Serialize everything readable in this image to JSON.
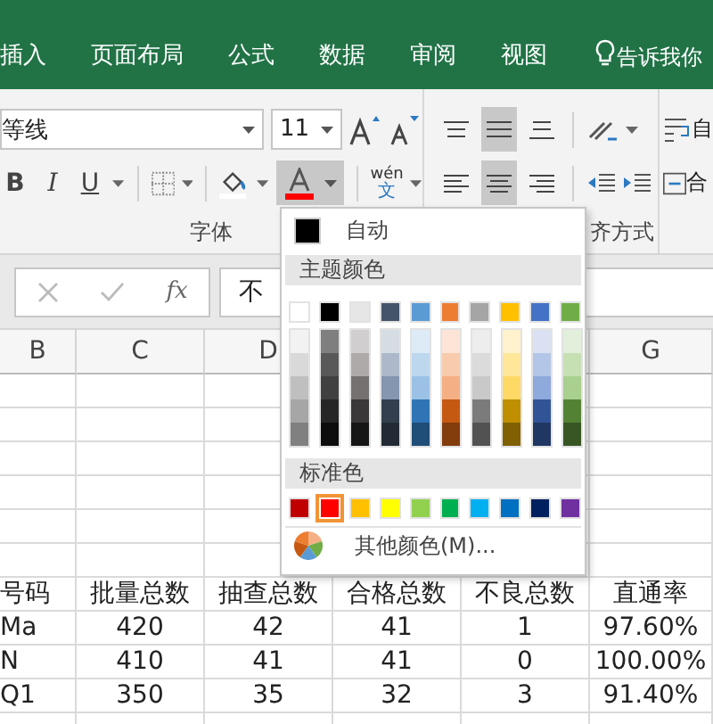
{
  "ribbon_tabs": [
    {
      "label": "插入"
    },
    {
      "label": "页面布局"
    },
    {
      "label": "公式"
    },
    {
      "label": "数据"
    },
    {
      "label": "审阅"
    },
    {
      "label": "视图"
    }
  ],
  "tell_me": "告诉我你",
  "font_group": {
    "font_name": "等线",
    "font_size": "11",
    "phonetic": "wén",
    "phonetic_char": "文",
    "label": "字体",
    "font_color_pressed": true,
    "bold": "B",
    "italic": "I",
    "underline": "U"
  },
  "alignment_group": {
    "label": "齐方式",
    "vertical": [
      {
        "selected": false
      },
      {
        "selected": true
      },
      {
        "selected": false
      }
    ],
    "horizontal": [
      {
        "selected": false
      },
      {
        "selected": true
      },
      {
        "selected": false
      }
    ]
  },
  "wrap_text_label": "自",
  "merge_label": "合",
  "formula_bar": {
    "fx": "fx",
    "value": "不"
  },
  "column_headers": [
    "B",
    "C",
    "D",
    "G"
  ],
  "table": {
    "header": [
      "号码",
      "批量总数",
      "抽查总数",
      "合格总数",
      "不良总数",
      "直通率"
    ],
    "rows": [
      [
        "Ma",
        "420",
        "42",
        "41",
        "1",
        "97.60%"
      ],
      [
        "N",
        "410",
        "41",
        "41",
        "0",
        "100.00%"
      ],
      [
        "Q1",
        "350",
        "35",
        "32",
        "3",
        "91.40%"
      ]
    ]
  },
  "color_menu": {
    "automatic": "自动",
    "theme_title": "主题颜色",
    "standard_title": "标准色",
    "more_colors": "其他颜色(M)...",
    "theme_colors": [
      {
        "color": "#ffffff",
        "selected": false,
        "shades": [
          {
            "color": "#f2f2f2",
            "selected": false
          },
          {
            "color": "#d9d9d9",
            "selected": false
          },
          {
            "color": "#bfbfbf",
            "selected": false
          },
          {
            "color": "#a6a6a6",
            "selected": false
          },
          {
            "color": "#808080",
            "selected": false
          }
        ]
      },
      {
        "color": "#000000",
        "selected": false,
        "shades": [
          {
            "color": "#7f7f7f",
            "selected": false
          },
          {
            "color": "#595959",
            "selected": false
          },
          {
            "color": "#404040",
            "selected": false
          },
          {
            "color": "#262626",
            "selected": false
          },
          {
            "color": "#0d0d0d",
            "selected": false
          }
        ]
      },
      {
        "color": "#e7e6e6",
        "selected": false,
        "shades": [
          {
            "color": "#d0cece",
            "selected": false
          },
          {
            "color": "#aeaaaa",
            "selected": false
          },
          {
            "color": "#757171",
            "selected": false
          },
          {
            "color": "#3a3838",
            "selected": false
          },
          {
            "color": "#171616",
            "selected": false
          }
        ]
      },
      {
        "color": "#44546a",
        "selected": false,
        "shades": [
          {
            "color": "#d6dce4",
            "selected": false
          },
          {
            "color": "#adb9ca",
            "selected": false
          },
          {
            "color": "#8496b0",
            "selected": false
          },
          {
            "color": "#333f4f",
            "selected": false
          },
          {
            "color": "#222a35",
            "selected": false
          }
        ]
      },
      {
        "color": "#5b9bd5",
        "selected": false,
        "shades": [
          {
            "color": "#ddebf7",
            "selected": false
          },
          {
            "color": "#bdd7ee",
            "selected": false
          },
          {
            "color": "#9bc2e6",
            "selected": false
          },
          {
            "color": "#2f75b5",
            "selected": false
          },
          {
            "color": "#1f4e78",
            "selected": false
          }
        ]
      },
      {
        "color": "#ed7d31",
        "selected": false,
        "shades": [
          {
            "color": "#fce4d6",
            "selected": false
          },
          {
            "color": "#f8cbad",
            "selected": false
          },
          {
            "color": "#f4b084",
            "selected": false
          },
          {
            "color": "#c65911",
            "selected": false
          },
          {
            "color": "#833c0c",
            "selected": false
          }
        ]
      },
      {
        "color": "#a5a5a5",
        "selected": false,
        "shades": [
          {
            "color": "#ededed",
            "selected": false
          },
          {
            "color": "#dbdbdb",
            "selected": false
          },
          {
            "color": "#c9c9c9",
            "selected": false
          },
          {
            "color": "#7b7b7b",
            "selected": false
          },
          {
            "color": "#525252",
            "selected": false
          }
        ]
      },
      {
        "color": "#ffc000",
        "selected": false,
        "shades": [
          {
            "color": "#fff2cc",
            "selected": false
          },
          {
            "color": "#ffe699",
            "selected": false
          },
          {
            "color": "#ffd966",
            "selected": false
          },
          {
            "color": "#bf8f00",
            "selected": false
          },
          {
            "color": "#806000",
            "selected": false
          }
        ]
      },
      {
        "color": "#4472c4",
        "selected": false,
        "shades": [
          {
            "color": "#d9e1f2",
            "selected": false
          },
          {
            "color": "#b4c6e7",
            "selected": false
          },
          {
            "color": "#8ea9db",
            "selected": false
          },
          {
            "color": "#305496",
            "selected": false
          },
          {
            "color": "#203764",
            "selected": false
          }
        ]
      },
      {
        "color": "#70ad47",
        "selected": false,
        "shades": [
          {
            "color": "#e2efda",
            "selected": false
          },
          {
            "color": "#c6e0b4",
            "selected": false
          },
          {
            "color": "#a9d08e",
            "selected": false
          },
          {
            "color": "#548235",
            "selected": false
          },
          {
            "color": "#375623",
            "selected": false
          }
        ]
      }
    ],
    "standard_colors": [
      {
        "color": "#c00000",
        "selected": false
      },
      {
        "color": "#ff0000",
        "selected": true
      },
      {
        "color": "#ffc000",
        "selected": false
      },
      {
        "color": "#ffff00",
        "selected": false
      },
      {
        "color": "#92d050",
        "selected": false
      },
      {
        "color": "#00b050",
        "selected": false
      },
      {
        "color": "#00b0f0",
        "selected": false
      },
      {
        "color": "#0070c0",
        "selected": false
      },
      {
        "color": "#002060",
        "selected": false
      },
      {
        "color": "#7030a0",
        "selected": false
      }
    ]
  }
}
